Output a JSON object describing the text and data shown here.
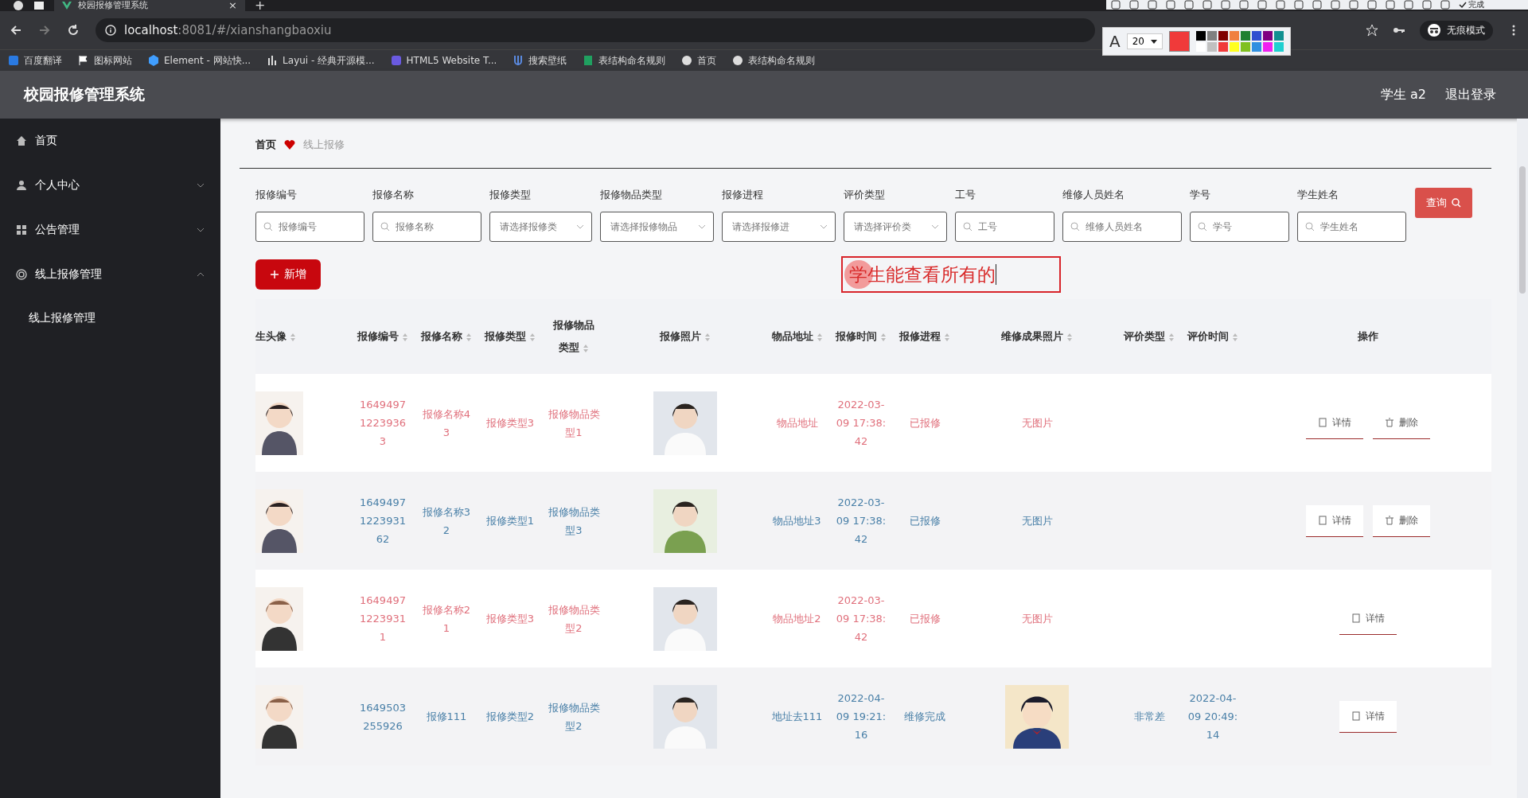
{
  "browser": {
    "tab_title": "校园报修管理系统",
    "tab_close": "×",
    "new_tab": "+",
    "url_host": "localhost",
    "url_path": ":8081/#/xianshangbaoxiu",
    "incognito": "无痕模式",
    "bookmarks": [
      {
        "label": "百度翻译",
        "kind": "translate"
      },
      {
        "label": "图标网站",
        "kind": "flag"
      },
      {
        "label": "Element - 网站快...",
        "kind": "hex"
      },
      {
        "label": "Layui - 经典开源模...",
        "kind": "bars"
      },
      {
        "label": "HTML5 Website T...",
        "kind": "box"
      },
      {
        "label": "搜索壁纸",
        "kind": "fork"
      },
      {
        "label": "表结构命名规则",
        "kind": "sheet"
      },
      {
        "label": "首页",
        "kind": "globe"
      },
      {
        "label": "表结构命名规则",
        "kind": "globe"
      }
    ]
  },
  "annotation_toolbar": {
    "done": "完成",
    "font_letter": "A",
    "font_size": "20",
    "swatches": [
      {
        "color": "#000000"
      },
      {
        "color": "#808080"
      },
      {
        "color": "#800000"
      },
      {
        "color": "#f08040"
      },
      {
        "color": "#208030"
      },
      {
        "color": "#3050d0"
      },
      {
        "color": "#800080"
      },
      {
        "color": "#109090"
      },
      {
        "color": "#ffffff"
      },
      {
        "color": "#c0c0c0"
      },
      {
        "color": "#f03a3a"
      },
      {
        "color": "#ffff20"
      },
      {
        "color": "#80c020"
      },
      {
        "color": "#3090e0"
      },
      {
        "color": "#f020f0"
      },
      {
        "color": "#20d0d0"
      }
    ]
  },
  "app": {
    "title": "校园报修管理系统",
    "user": "学生 a2",
    "logout": "退出登录"
  },
  "sidebar": {
    "items": [
      {
        "label": "首页",
        "kind": "home"
      },
      {
        "label": "个人中心",
        "kind": "user",
        "expanded": false
      },
      {
        "label": "公告管理",
        "kind": "grid",
        "expanded": false
      },
      {
        "label": "线上报修管理",
        "kind": "ring",
        "expanded": true,
        "children": [
          {
            "label": "线上报修管理"
          }
        ]
      }
    ]
  },
  "breadcrumb": {
    "home": "首页",
    "current": "线上报修"
  },
  "search_form": {
    "fields": [
      {
        "label": "报修编号",
        "placeholder": "报修编号",
        "kind": "text"
      },
      {
        "label": "报修名称",
        "placeholder": "报修名称",
        "kind": "text"
      },
      {
        "label": "报修类型",
        "placeholder": "请选择报修类",
        "kind": "select"
      },
      {
        "label": "报修物品类型",
        "placeholder": "请选择报修物品",
        "kind": "select"
      },
      {
        "label": "报修进程",
        "placeholder": "请选择报修进",
        "kind": "select"
      },
      {
        "label": "评价类型",
        "placeholder": "请选择评价类",
        "kind": "select"
      },
      {
        "label": "工号",
        "placeholder": "工号",
        "kind": "text"
      },
      {
        "label": "维修人员姓名",
        "placeholder": "维修人员姓名",
        "kind": "text"
      },
      {
        "label": "学号",
        "placeholder": "学号",
        "kind": "text"
      },
      {
        "label": "学生姓名",
        "placeholder": "学生姓名",
        "kind": "text"
      }
    ],
    "query": "查询",
    "add": "新增"
  },
  "annotation_text": "学生能查看所有的",
  "table": {
    "columns": [
      {
        "label": "生头像",
        "sortable": true
      },
      {
        "label": "报修编号",
        "sortable": true
      },
      {
        "label": "报修名称",
        "sortable": true
      },
      {
        "label": "报修类型",
        "sortable": true
      },
      {
        "label": "报修物品类型",
        "sortable": true
      },
      {
        "label": "报修照片",
        "sortable": true
      },
      {
        "label": "物品地址",
        "sortable": true
      },
      {
        "label": "报修时间",
        "sortable": true
      },
      {
        "label": "报修进程",
        "sortable": true
      },
      {
        "label": "维修成果照片",
        "sortable": true
      },
      {
        "label": "评价类型",
        "sortable": true
      },
      {
        "label": "评价时间",
        "sortable": true
      },
      {
        "label": "操作",
        "sortable": false
      }
    ],
    "rows": [
      {
        "color": "#e0707c",
        "avatar": {
          "kind": "picture"
        },
        "id": "164949712239363",
        "name": "报修名称43",
        "type": "报修类型3",
        "item_type": "报修物品类型1",
        "photo": {
          "kind": "picture"
        },
        "address": "物品地址",
        "time": "2022-03-09 17:38:42",
        "progress": "已报修",
        "result_photo": {
          "kind": "text",
          "text": "无图片"
        },
        "actions": [
          {
            "label": "详情",
            "kind": "detail"
          },
          {
            "label": "删除",
            "kind": "delete"
          }
        ]
      },
      {
        "color": "#4a80a8",
        "avatar": {
          "kind": "picture"
        },
        "id": "1649497122393162",
        "name": "报修名称32",
        "type": "报修类型1",
        "item_type": "报修物品类型3",
        "photo": {
          "kind": "picture"
        },
        "address": "物品地址3",
        "time": "2022-03-09 17:38:42",
        "progress": "已报修",
        "result_photo": {
          "kind": "text",
          "text": "无图片"
        },
        "actions": [
          {
            "label": "详情",
            "kind": "detail"
          },
          {
            "label": "删除",
            "kind": "delete"
          }
        ]
      },
      {
        "color": "#e0707c",
        "avatar": {
          "kind": "picture"
        },
        "id": "164949712239311",
        "name": "报修名称21",
        "type": "报修类型3",
        "item_type": "报修物品类型2",
        "photo": {
          "kind": "picture"
        },
        "address": "物品地址2",
        "time": "2022-03-09 17:38:42",
        "progress": "已报修",
        "result_photo": {
          "kind": "text",
          "text": "无图片"
        },
        "actions": [
          {
            "label": "详情",
            "kind": "detail"
          }
        ]
      },
      {
        "color": "#4a80a8",
        "avatar": {
          "kind": "picture"
        },
        "id": "1649503255926",
        "name": "报修111",
        "type": "报修类型2",
        "item_type": "报修物品类型2",
        "photo": {
          "kind": "picture"
        },
        "address": "地址去111",
        "time": "2022-04-09 19:21:16",
        "progress": "维修完成",
        "result_photo": {
          "kind": "picture"
        },
        "rating": "非常差",
        "rating_time": "2022-04-09 20:49:14",
        "actions": [
          {
            "label": "详情",
            "kind": "detail"
          }
        ]
      }
    ]
  }
}
